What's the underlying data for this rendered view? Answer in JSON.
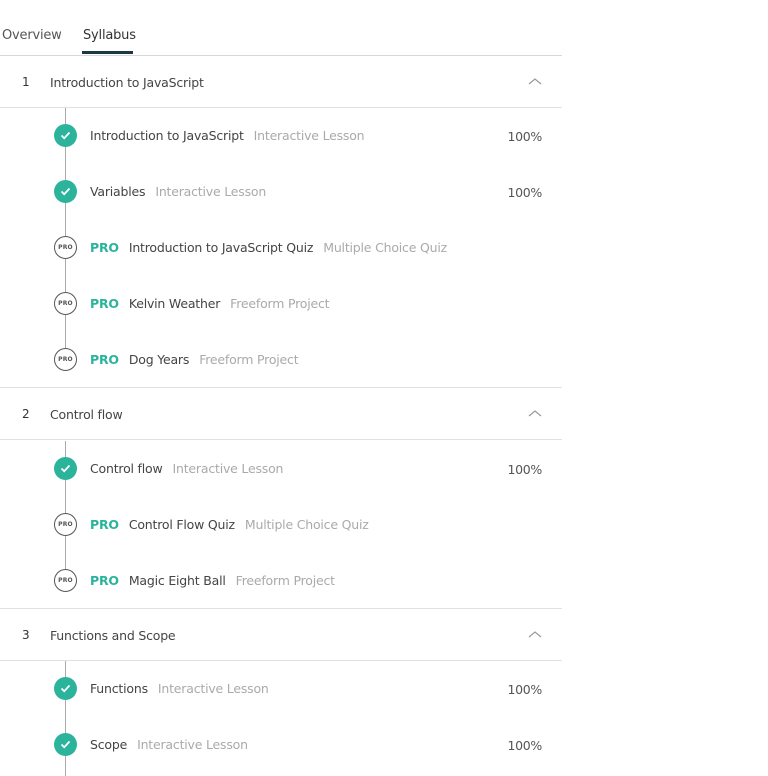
{
  "tabs": {
    "overview": "Overview",
    "syllabus": "Syllabus",
    "active": "Syllabus"
  },
  "colors": {
    "accent": "#2bb39c",
    "tab_underline": "#1a3a3f",
    "muted_text": "#aaaaaa"
  },
  "modules": [
    {
      "number": "1",
      "title": "Introduction to JavaScript",
      "expanded": true,
      "lessons": [
        {
          "title": "Introduction to JavaScript",
          "type": "Interactive Lesson",
          "status": "complete",
          "pro": false,
          "progress": "100%"
        },
        {
          "title": "Variables",
          "type": "Interactive Lesson",
          "status": "complete",
          "pro": false,
          "progress": "100%"
        },
        {
          "title": "Introduction to JavaScript Quiz",
          "type": "Multiple Choice Quiz",
          "status": "pro",
          "pro": true,
          "pro_label": "PRO"
        },
        {
          "title": "Kelvin Weather",
          "type": "Freeform Project",
          "status": "pro",
          "pro": true,
          "pro_label": "PRO"
        },
        {
          "title": "Dog Years",
          "type": "Freeform Project",
          "status": "pro",
          "pro": true,
          "pro_label": "PRO"
        }
      ]
    },
    {
      "number": "2",
      "title": "Control flow",
      "expanded": true,
      "lessons": [
        {
          "title": "Control flow",
          "type": "Interactive Lesson",
          "status": "complete",
          "pro": false,
          "progress": "100%"
        },
        {
          "title": "Control Flow Quiz",
          "type": "Multiple Choice Quiz",
          "status": "pro",
          "pro": true,
          "pro_label": "PRO"
        },
        {
          "title": "Magic Eight Ball",
          "type": "Freeform Project",
          "status": "pro",
          "pro": true,
          "pro_label": "PRO"
        }
      ]
    },
    {
      "number": "3",
      "title": "Functions and Scope",
      "expanded": true,
      "lessons": [
        {
          "title": "Functions",
          "type": "Interactive Lesson",
          "status": "complete",
          "pro": false,
          "progress": "100%"
        },
        {
          "title": "Scope",
          "type": "Interactive Lesson",
          "status": "complete",
          "pro": false,
          "progress": "100%"
        }
      ]
    }
  ],
  "icons": {
    "complete": "check-circle-icon",
    "pro": "pro-badge-icon",
    "collapse": "chevron-up-icon"
  }
}
